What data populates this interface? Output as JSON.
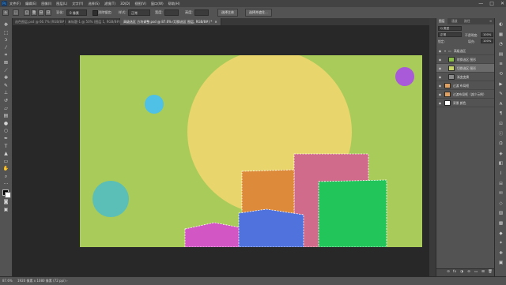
{
  "app": {
    "logo": "Ps"
  },
  "menu": {
    "items": [
      "文件(F)",
      "编辑(E)",
      "图像(I)",
      "图层(L)",
      "文字(Y)",
      "选择(S)",
      "滤镜(T)",
      "3D(D)",
      "视图(V)",
      "窗口(W)",
      "帮助(H)"
    ]
  },
  "window_controls": {
    "minimize": "—",
    "maximize": "□",
    "close": "✕"
  },
  "options": {
    "feather_label": "羽化:",
    "feather_value": "0 像素",
    "antialias_label": "消除锯齿",
    "style_label": "样式:",
    "style_value": "正常",
    "width_label": "宽度:",
    "height_label": "高度:",
    "select_subject": "选择主体",
    "select_and_mask": "选择并遮住..."
  },
  "tabs": [
    {
      "label": "选色图层.psd @ 66.7% (RGB/8#)",
      "close": "×"
    },
    {
      "label": "未标题-1 @ 50% (图层 1, RGB/8#)",
      "close": "×"
    },
    {
      "label": "高级选区 方块调整.psd @ 87.6% (切换选区 图层, RGB/8#) *",
      "close": "×",
      "active": true
    }
  ],
  "toolbar": {
    "tools": [
      {
        "name": "move-tool-icon",
        "glyph": "✥"
      },
      {
        "name": "marquee-tool-icon",
        "glyph": "⬚"
      },
      {
        "name": "lasso-tool-icon",
        "glyph": "ↄ"
      },
      {
        "name": "magic-wand-tool-icon",
        "glyph": "⁄"
      },
      {
        "name": "crop-tool-icon",
        "glyph": "⌗"
      },
      {
        "name": "frame-tool-icon",
        "glyph": "⊠"
      },
      {
        "name": "eyedropper-tool-icon",
        "glyph": "⟋"
      },
      {
        "name": "healing-brush-tool-icon",
        "glyph": "✚"
      },
      {
        "name": "brush-tool-icon",
        "glyph": "✎"
      },
      {
        "name": "clone-stamp-tool-icon",
        "glyph": "⊥"
      },
      {
        "name": "history-brush-tool-icon",
        "glyph": "↺"
      },
      {
        "name": "eraser-tool-icon",
        "glyph": "▱"
      },
      {
        "name": "gradient-tool-icon",
        "glyph": "▤"
      },
      {
        "name": "blur-tool-icon",
        "glyph": "●"
      },
      {
        "name": "dodge-tool-icon",
        "glyph": "○"
      },
      {
        "name": "pen-tool-icon",
        "glyph": "✒"
      },
      {
        "name": "type-tool-icon",
        "glyph": "T"
      },
      {
        "name": "path-selection-tool-icon",
        "glyph": "▲"
      },
      {
        "name": "rectangle-tool-icon",
        "glyph": "▭"
      },
      {
        "name": "hand-tool-icon",
        "glyph": "✋"
      },
      {
        "name": "zoom-tool-icon",
        "glyph": "⌕"
      },
      {
        "name": "more-tools-icon",
        "glyph": "···"
      }
    ],
    "quick_mask": "◙",
    "screen_mode": "▣"
  },
  "status": {
    "zoom": "87.6%",
    "doc": "1920 像素 x 1080 像素 (72 ppi)",
    "arrow": "›"
  },
  "canvas": {
    "background": "#a9cb5a",
    "sun_color": "#e8d56c",
    "cyan_dot_color": "#4fc0e6",
    "purple_dot_color": "#a85ad8",
    "teal_circle_color": "#5bbfb7",
    "orange_block_color": "#dd8b3b",
    "pink_block_color": "#d06b8b",
    "green_block_color": "#22c55a",
    "blue_block_color": "#4f72dd",
    "magenta_block_color": "#d256c4"
  },
  "layers_panel": {
    "tabs": [
      "图层",
      "通道",
      "路径"
    ],
    "menu_icon": "≡",
    "kind_filter": "Q 类型",
    "blend_mode": "正常",
    "opacity_label": "不透明度:",
    "opacity_value": "100%",
    "lock_label": "锁定:",
    "fill_label": "填充:",
    "fill_value": "100%",
    "footer_icons": [
      "⊝",
      "fx",
      "◑",
      "⊖",
      "▭",
      "⊞",
      "🗑"
    ],
    "layers": [
      {
        "name": "高级选区",
        "type": "group",
        "thumb_color": "#6a6a6a",
        "indent": 0
      },
      {
        "name": "转换选区 图形",
        "type": "layer",
        "thumb_color": "#8bbf4a",
        "indent": 1
      },
      {
        "name": "切换选区 图形",
        "type": "layer",
        "thumb_color": "#c7d46a",
        "indent": 1,
        "selected": true
      },
      {
        "name": "渐变变换",
        "type": "layer",
        "thumb_color": "#8a8a8a",
        "indent": 1
      },
      {
        "name": "过渡 布局框",
        "type": "layer",
        "thumb_color": "#e3a160",
        "indent": 0
      },
      {
        "name": "过渡布局框（减少示例）",
        "type": "layer",
        "thumb_color": "#e3a160",
        "indent": 0
      },
      {
        "name": "背景 颜色",
        "type": "layer",
        "thumb_color": "#ffffff",
        "indent": 0
      }
    ]
  },
  "right_dock": {
    "icons": [
      "color-panel-icon",
      "swatches-panel-icon",
      "adjustments-panel-icon",
      "libraries-panel-icon",
      "properties-panel-icon",
      "history-panel-icon",
      "actions-panel-icon",
      "brushes-panel-icon",
      "character-panel-icon",
      "paragraph-panel-icon",
      "navigator-panel-icon",
      "info-panel-icon",
      "glyphs-panel-icon",
      "styles-panel-icon",
      "channels-dock-icon",
      "paths-dock-icon",
      "timeline-panel-icon",
      "notes-panel-icon",
      "3d-panel-icon",
      "gradients-panel-icon",
      "patterns-panel-icon",
      "shapes-panel-icon",
      "learn-panel-icon",
      "comments-panel-icon",
      "layer-comps-panel-icon"
    ],
    "glyphs": [
      "◐",
      "▦",
      "◔",
      "▤",
      "≡",
      "⟲",
      "▶",
      "✎",
      "A",
      "¶",
      "⊡",
      "ⓘ",
      "Ω",
      "◈",
      "◧",
      "⌇",
      "⊟",
      "✉",
      "◇",
      "▨",
      "▩",
      "◆",
      "✦",
      "✚",
      "▣"
    ]
  }
}
